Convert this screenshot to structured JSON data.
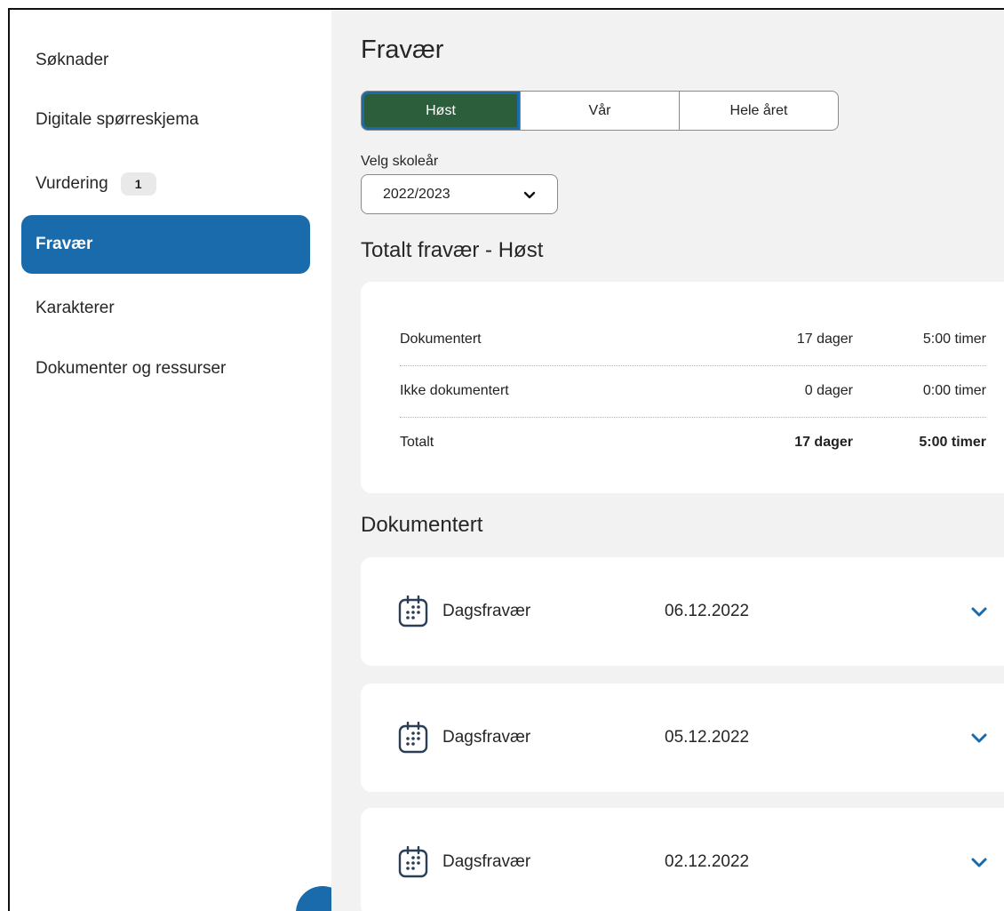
{
  "sidebar": {
    "items": [
      {
        "label": "Søknader"
      },
      {
        "label": "Digitale spørreskjema"
      },
      {
        "label": "Vurdering",
        "badge": "1"
      },
      {
        "label": "Fravær",
        "active": true
      },
      {
        "label": "Karakterer"
      },
      {
        "label": "Dokumenter og ressurser"
      }
    ]
  },
  "main": {
    "title": "Fravær",
    "semester_tabs": [
      {
        "label": "Høst",
        "active": true
      },
      {
        "label": "Vår"
      },
      {
        "label": "Hele året"
      }
    ],
    "year_select": {
      "label": "Velg skoleår",
      "value": "2022/2023"
    },
    "summary": {
      "heading": "Totalt fravær - Høst",
      "rows": [
        {
          "label": "Dokumentert",
          "days": "17 dager",
          "hours": "5:00 timer"
        },
        {
          "label": "Ikke dokumentert",
          "days": "0 dager",
          "hours": "0:00 timer"
        },
        {
          "label": "Totalt",
          "days": "17 dager",
          "hours": "5:00 timer"
        }
      ]
    },
    "documented": {
      "heading": "Dokumentert",
      "items": [
        {
          "type": "Dagsfravær",
          "date": "06.12.2022",
          "icon": "calendar-icon"
        },
        {
          "type": "Dagsfravær",
          "date": "05.12.2022",
          "icon": "calendar-icon"
        },
        {
          "type": "Dagsfravær",
          "date": "02.12.2022",
          "icon": "calendar-icon"
        }
      ]
    }
  },
  "colors": {
    "accent": "#1a6bab",
    "active_tab": "#2d5e3c",
    "main_bg": "#f2f2f2"
  }
}
